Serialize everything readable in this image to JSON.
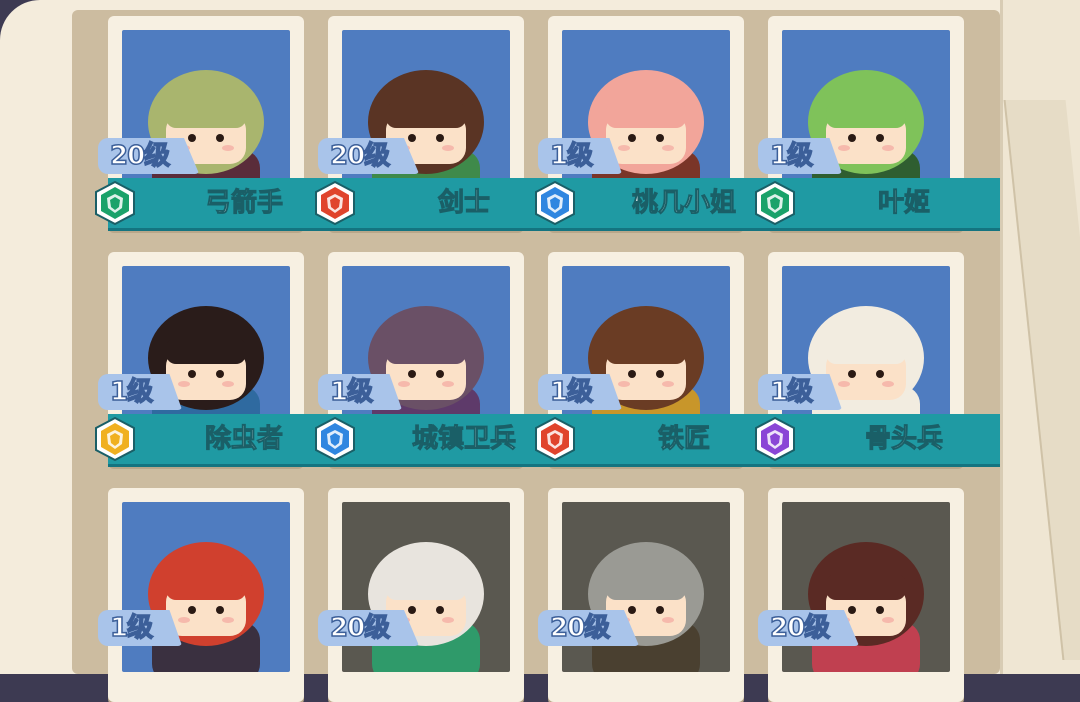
{
  "heroes": [
    {
      "level": "20级",
      "name": "弓箭手",
      "class_icon": "ranger-hex-icon",
      "class_color": "#1aa26a",
      "locked": false,
      "hair": "#a9b56e",
      "shirt": "#5a2c3a"
    },
    {
      "level": "20级",
      "name": "剑士",
      "class_icon": "warrior-hex-icon",
      "class_color": "#e0442c",
      "locked": false,
      "hair": "#5a3424",
      "shirt": "#3f8a4a"
    },
    {
      "level": "1级",
      "name": "桃几小姐",
      "class_icon": "mage-hex-icon",
      "class_color": "#2f86e0",
      "locked": false,
      "hair": "#f2a59a",
      "shirt": "#7a3528"
    },
    {
      "level": "1级",
      "name": "叶姬",
      "class_icon": "ranger-hex-icon",
      "class_color": "#1aa26a",
      "locked": false,
      "hair": "#7fc25a",
      "shirt": "#2f5e30"
    },
    {
      "level": "1级",
      "name": "除虫者",
      "class_icon": "support-hex-icon",
      "class_color": "#f0b020",
      "locked": false,
      "hair": "#2a1c1a",
      "shirt": "#2f6aa0"
    },
    {
      "level": "1级",
      "name": "城镇卫兵",
      "class_icon": "tank-hex-icon",
      "class_color": "#2f86e0",
      "locked": false,
      "hair": "#6a5066",
      "shirt": "#5e3a6a"
    },
    {
      "level": "1级",
      "name": "铁匠",
      "class_icon": "warrior-hex-icon",
      "class_color": "#e0442c",
      "locked": false,
      "hair": "#6a3c24",
      "shirt": "#c8962a"
    },
    {
      "level": "1级",
      "name": "骨头兵",
      "class_icon": "undead-hex-icon",
      "class_color": "#8a46d6",
      "locked": false,
      "hair": "#f2ece0",
      "shirt": "#f2ece0"
    },
    {
      "level": "1级",
      "name": "",
      "class_icon": "",
      "class_color": "",
      "locked": false,
      "hair": "#d0402e",
      "shirt": "#3a3040"
    },
    {
      "level": "20级",
      "name": "",
      "class_icon": "",
      "class_color": "",
      "locked": true,
      "hair": "#e8e4de",
      "shirt": "#2f9a6a"
    },
    {
      "level": "20级",
      "name": "",
      "class_icon": "",
      "class_color": "",
      "locked": true,
      "hair": "#9a9a94",
      "shirt": "#4a4030"
    },
    {
      "level": "20级",
      "name": "",
      "class_icon": "",
      "class_color": "",
      "locked": true,
      "hair": "#5a2a24",
      "shirt": "#c04050"
    }
  ],
  "colors": {
    "name_bar": "#1f9aa3",
    "portrait_bg": "#4f7cc0",
    "portrait_locked_bg": "#5a5850",
    "level_badge": "#a9c4ea"
  }
}
